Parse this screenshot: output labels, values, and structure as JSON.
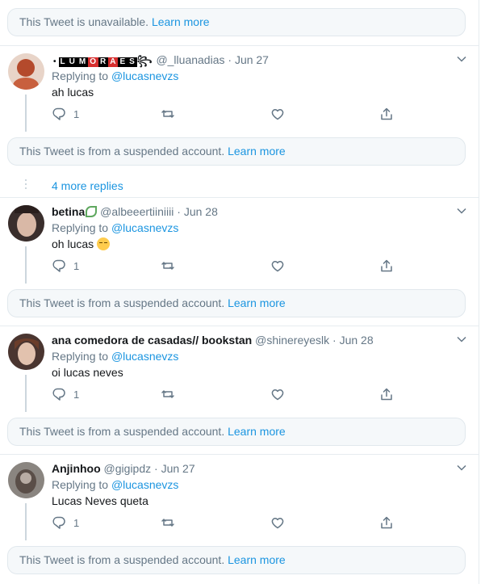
{
  "notices": {
    "unavailable": {
      "text": "This Tweet is unavailable.",
      "link": "Learn more"
    },
    "suspended": {
      "text": "This Tweet is from a suspended account.",
      "link": "Learn more"
    }
  },
  "more_replies": "4 more replies",
  "replying_label": "Replying to",
  "tweets": [
    {
      "name": ".•LUMORAES",
      "handle": "@_lluanadias",
      "sep": "·",
      "date": "Jun 27",
      "replying_to": "@lucasnevzs",
      "text": "ah lucas",
      "reply_count": "1"
    },
    {
      "name": "betina",
      "handle": "@albeeertiiniiii",
      "sep": "·",
      "date": "Jun 28",
      "replying_to": "@lucasnevzs",
      "text": "oh lucas",
      "reply_count": "1"
    },
    {
      "name": "ana comedora de casadas// bookstan",
      "handle": "@shinereyeslk",
      "sep": "·",
      "date": "Jun 28",
      "replying_to": "@lucasnevzs",
      "text": "oi lucas neves",
      "reply_count": "1"
    },
    {
      "name": "Anjinhoo",
      "handle": "@gigipdz",
      "sep": "·",
      "date": "Jun 27",
      "replying_to": "@lucasnevzs",
      "text": "Lucas Neves queta",
      "reply_count": "1"
    }
  ],
  "colors": {
    "link": "#1b95e0",
    "muted": "#657786",
    "text": "#14171a",
    "notice_bg": "#f5f8fa",
    "border": "#e6ecf0"
  }
}
